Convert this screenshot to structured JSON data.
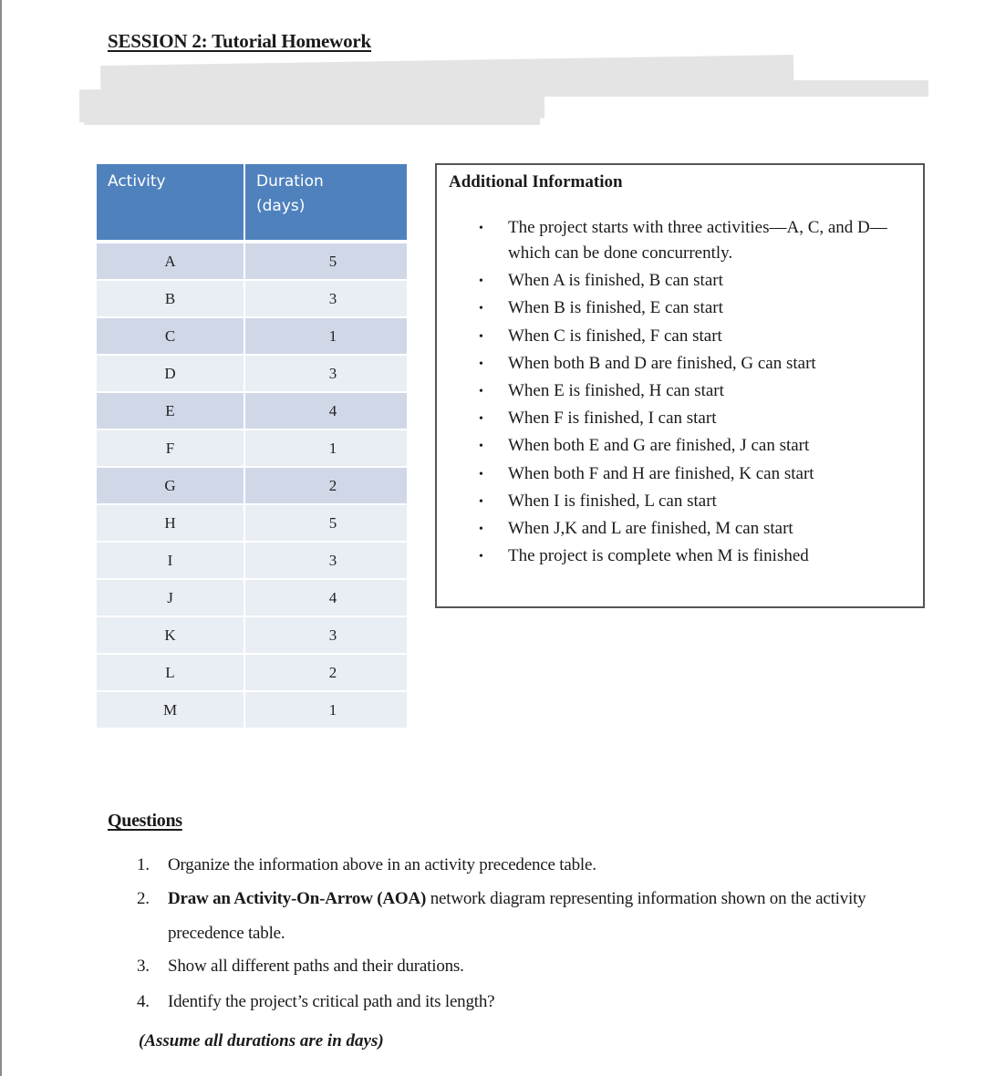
{
  "title": "SESSION 2: Tutorial Homework",
  "activity_table": {
    "headers": [
      "Activity",
      "Duration\n(days)"
    ],
    "header_activity": "Activity",
    "header_duration_line1": "Duration",
    "header_duration_line2": "(days)",
    "rows": [
      {
        "activity": "A",
        "duration": "5"
      },
      {
        "activity": "B",
        "duration": "3"
      },
      {
        "activity": "C",
        "duration": "1"
      },
      {
        "activity": "D",
        "duration": "3"
      },
      {
        "activity": "E",
        "duration": "4"
      },
      {
        "activity": "F",
        "duration": "1"
      },
      {
        "activity": "G",
        "duration": "2"
      },
      {
        "activity": "H",
        "duration": "5"
      },
      {
        "activity": "I",
        "duration": "3"
      },
      {
        "activity": "J",
        "duration": "4"
      },
      {
        "activity": "K",
        "duration": "3"
      },
      {
        "activity": "L",
        "duration": "2"
      },
      {
        "activity": "M",
        "duration": "1"
      }
    ],
    "colors": {
      "header": "#4f81bd",
      "band_dark": "#d0d8e8",
      "band_light": "#e9edf4"
    }
  },
  "additional_info": {
    "title": "Additional Information",
    "bullet": "•",
    "items": [
      "The project starts with three activities—A, C, and D—which can be done concurrently.",
      "When A is finished, B can start",
      "When B is finished, E can start",
      "When C is finished, F can start",
      "When both B and D are finished, G can start",
      "When E is finished, H can start",
      "When F is finished, I can start",
      "When both E and G are finished, J can start",
      "When both F and H are finished, K can start",
      "When I is finished, L can start",
      "When J,K and L are finished, M can start",
      "The project is complete when M is finished"
    ]
  },
  "questions": {
    "title": "Questions",
    "items": [
      {
        "num": "1.",
        "text": "Organize the information above in an activity precedence table."
      },
      {
        "num": "2.",
        "bold_text": "Draw an Activity-On-Arrow (AOA)",
        "text": " network diagram representing information shown on the activity precedence table."
      },
      {
        "num": "3.",
        "text": "Show all different paths and their durations."
      },
      {
        "num": "4.",
        "text": "Identify the project’s critical path and its length?"
      }
    ],
    "note": "(Assume all durations are in days)"
  }
}
